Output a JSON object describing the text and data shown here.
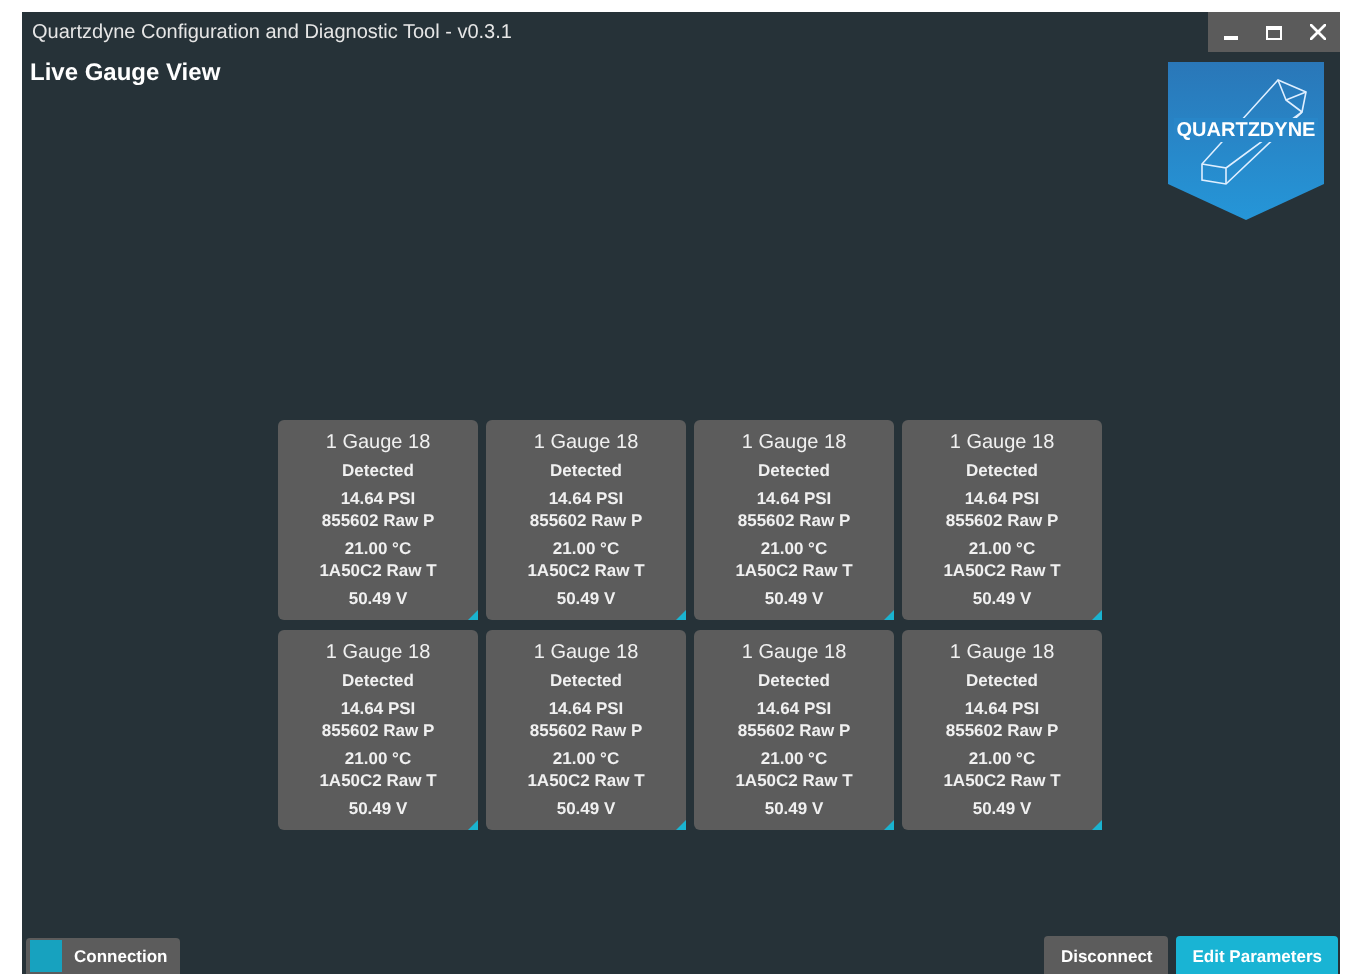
{
  "window": {
    "title": "Quartzdyne Configuration and Diagnostic Tool - v0.3.1"
  },
  "page_title": "Live Gauge View",
  "logo": {
    "text": "QUARTZDYNE"
  },
  "gauges": [
    {
      "name": "1 Gauge 18",
      "status": "Detected",
      "pressure": "14.64 PSI",
      "raw_p": "855602 Raw P",
      "temperature": "21.00 °C",
      "raw_t": "1A50C2 Raw T",
      "voltage": "50.49 V"
    },
    {
      "name": "1 Gauge 18",
      "status": "Detected",
      "pressure": "14.64 PSI",
      "raw_p": "855602 Raw P",
      "temperature": "21.00 °C",
      "raw_t": "1A50C2 Raw T",
      "voltage": "50.49 V"
    },
    {
      "name": "1 Gauge 18",
      "status": "Detected",
      "pressure": "14.64 PSI",
      "raw_p": "855602 Raw P",
      "temperature": "21.00 °C",
      "raw_t": "1A50C2 Raw T",
      "voltage": "50.49 V"
    },
    {
      "name": "1 Gauge 18",
      "status": "Detected",
      "pressure": "14.64 PSI",
      "raw_p": "855602 Raw P",
      "temperature": "21.00 °C",
      "raw_t": "1A50C2 Raw T",
      "voltage": "50.49 V"
    },
    {
      "name": "1 Gauge 18",
      "status": "Detected",
      "pressure": "14.64 PSI",
      "raw_p": "855602 Raw P",
      "temperature": "21.00 °C",
      "raw_t": "1A50C2 Raw T",
      "voltage": "50.49 V"
    },
    {
      "name": "1 Gauge 18",
      "status": "Detected",
      "pressure": "14.64 PSI",
      "raw_p": "855602 Raw P",
      "temperature": "21.00 °C",
      "raw_t": "1A50C2 Raw T",
      "voltage": "50.49 V"
    },
    {
      "name": "1 Gauge 18",
      "status": "Detected",
      "pressure": "14.64 PSI",
      "raw_p": "855602 Raw P",
      "temperature": "21.00 °C",
      "raw_t": "1A50C2 Raw T",
      "voltage": "50.49 V"
    },
    {
      "name": "1 Gauge 18",
      "status": "Detected",
      "pressure": "14.64 PSI",
      "raw_p": "855602 Raw P",
      "temperature": "21.00 °C",
      "raw_t": "1A50C2 Raw T",
      "voltage": "50.49 V"
    }
  ],
  "footer": {
    "connection": "Connection",
    "buttons": [
      {
        "label": "Disconnect",
        "kind": "secondary"
      },
      {
        "label": "Edit Parameters",
        "kind": "primary"
      }
    ]
  }
}
